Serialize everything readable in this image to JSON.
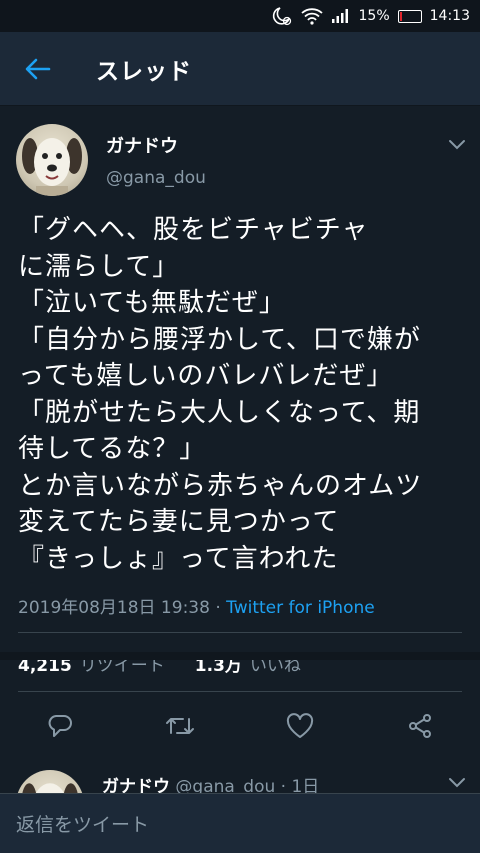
{
  "status_bar": {
    "battery": "15%",
    "battery_level": 0.15,
    "time": "14:13"
  },
  "header": {
    "title": "スレッド"
  },
  "tweet": {
    "author_name": "ガナドウ",
    "handle": "@gana_dou",
    "text": "「グヘヘ、股をビチャビチャ\nに濡らして」\n「泣いても無駄だぜ」\n「自分から腰浮かして、口で嫌が\nっても嬉しいのバレバレだぜ」\n「脱がせたら大人しくなって、期\n待してるな？」\nとか言いながら赤ちゃんのオムツ\n変えてたら妻に見つかって\n『きっしょ』って言われた",
    "timestamp": "2019年08月18日 19:38",
    "dot": " · ",
    "source": "Twitter for iPhone",
    "retweets": "4,215",
    "retweets_label": "リツイート",
    "likes": "1.3万",
    "likes_label": "いいね"
  },
  "reply": {
    "author_name": "ガナドウ",
    "handle_time": "@gana_dou · 1日"
  },
  "composer": {
    "placeholder": "返信をツイート"
  },
  "colors": {
    "accent": "#1da1f2",
    "background": "#141d26",
    "header": "#1c2938",
    "muted": "#8899a6"
  }
}
